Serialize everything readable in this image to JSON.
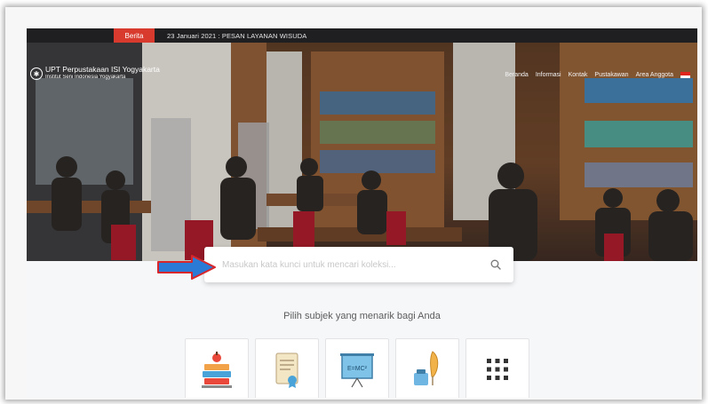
{
  "ticker": {
    "badge": "Berita",
    "text": "23 Januari 2021 : PESAN LAYANAN WISUDA"
  },
  "brand": {
    "name": "UPT Perpustakaan ISI Yogyakarta",
    "subtitle": "Institut Seni Indonesia Yogyakarta"
  },
  "nav": {
    "items": [
      {
        "label": "Beranda"
      },
      {
        "label": "Informasi"
      },
      {
        "label": "Kontak"
      },
      {
        "label": "Pustakawan"
      },
      {
        "label": "Area Anggota"
      }
    ],
    "language_flag_icon": "flag-id-icon"
  },
  "search": {
    "placeholder": "Masukan kata kunci untuk mencari koleksi...",
    "icon": "search-icon"
  },
  "subjects": {
    "title": "Pilih subjek yang menarik bagi Anda",
    "cards": [
      {
        "icon": "books-apple-icon"
      },
      {
        "icon": "certificate-scroll-icon"
      },
      {
        "icon": "presentation-board-icon"
      },
      {
        "icon": "ink-quill-icon"
      },
      {
        "icon": "grid-more-icon"
      }
    ]
  },
  "colors": {
    "ticker_bg": "#1f1f22",
    "badge": "#d83a2e",
    "arrow_fill": "#2b7bd6",
    "arrow_outline": "#d8262a"
  }
}
